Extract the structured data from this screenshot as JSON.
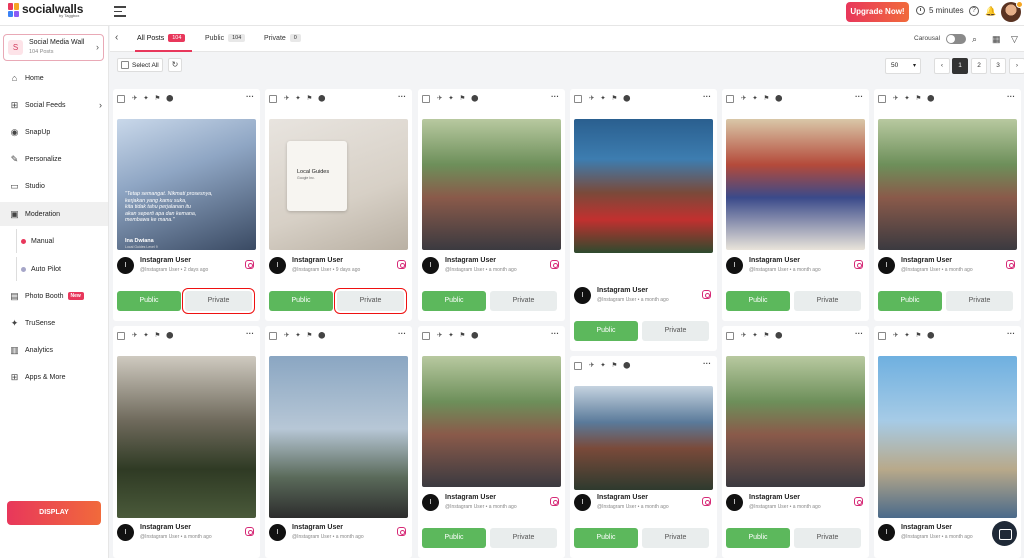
{
  "app": {
    "logo_text": "socialwalls",
    "logo_sub": "by Taggbox",
    "upgrade_label": "Upgrade Now!",
    "timer_label": "5 minutes"
  },
  "wall": {
    "initial": "S",
    "name": "Social Media Wall",
    "count": "104 Posts"
  },
  "sidebar": {
    "items": [
      {
        "label": "Home",
        "icon": "home-icon"
      },
      {
        "label": "Social Feeds",
        "icon": "feeds-icon"
      },
      {
        "label": "SnapUp",
        "icon": "snapup-icon"
      },
      {
        "label": "Personalize",
        "icon": "personalize-icon"
      },
      {
        "label": "Studio",
        "icon": "studio-icon"
      },
      {
        "label": "Moderation",
        "icon": "moderation-icon"
      },
      {
        "label": "Photo Booth",
        "icon": "photo-booth-icon",
        "badge": "New"
      },
      {
        "label": "TruSense",
        "icon": "trusense-icon"
      },
      {
        "label": "Analytics",
        "icon": "analytics-icon"
      },
      {
        "label": "Apps & More",
        "icon": "apps-icon"
      }
    ],
    "sub_items": [
      {
        "label": "Manual",
        "dot_color": "#e8375b"
      },
      {
        "label": "Auto Pilot",
        "dot_color": "#a6a6c8"
      }
    ],
    "display_label": "DISPLAY"
  },
  "tabs": [
    {
      "label": "All Posts",
      "count": "104"
    },
    {
      "label": "Public",
      "count": "104"
    },
    {
      "label": "Private",
      "count": "0"
    }
  ],
  "toolbar": {
    "carousel_label": "Carousal",
    "select_all_label": "Select All",
    "per_page": "50",
    "pages": [
      "1",
      "2",
      "3"
    ]
  },
  "post": {
    "user": "Instagram User",
    "handle": "@Instagram User",
    "public_label": "Public",
    "private_label": "Private"
  },
  "posts": [
    {
      "time": "2 days ago",
      "caption_lines": [
        "\"Tetap semangat. Nikmati prosesnya,",
        "kerjakan yang kamu suka,",
        "kita tidak tahu perjalanan itu",
        "akan seperti apa dan kemana,",
        "membawa ke mana.\""
      ],
      "author": "Ina Dwiana",
      "author_sub": "Local Guides Level 9"
    },
    {
      "time": "9 days ago",
      "bag_text": "Local Guides",
      "bag_sub": "Google Inc."
    },
    {
      "time": "a month ago"
    },
    {
      "time": "a month ago"
    },
    {
      "time": "a month ago"
    },
    {
      "time": "a month ago"
    },
    {
      "time": "a month ago"
    },
    {
      "time": "a month ago"
    },
    {
      "time": "a month ago"
    },
    {
      "time": "a month ago"
    },
    {
      "time": "a month ago"
    },
    {
      "time": "a month ago"
    }
  ],
  "colors": {
    "brand": "#e8375b",
    "public_green": "#5cb85c",
    "highlight_red": "#e11111"
  }
}
